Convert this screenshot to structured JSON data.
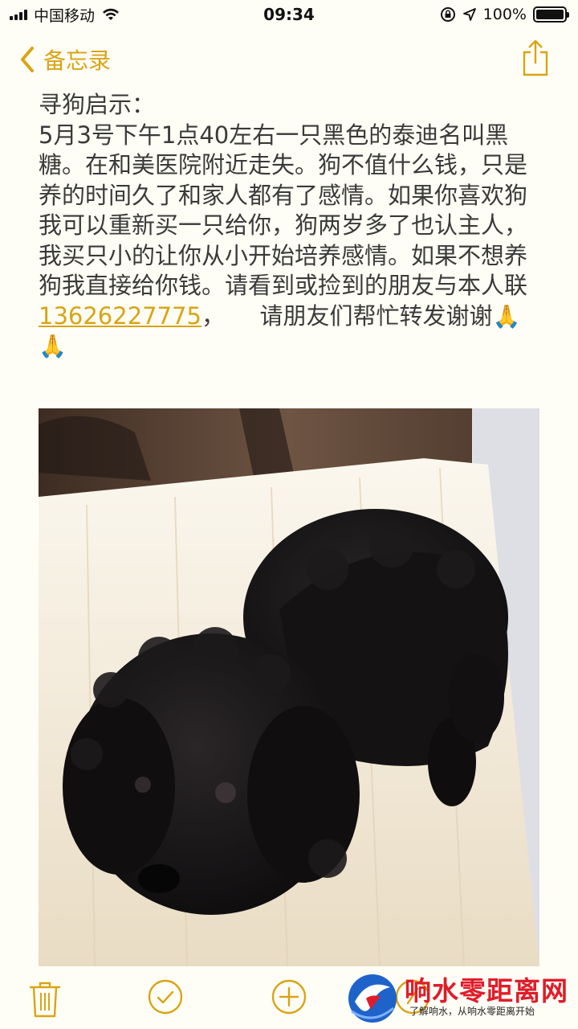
{
  "status": {
    "carrier": "中国移动",
    "time": "09:34",
    "battery_text": "100%",
    "battery_level": 1.0
  },
  "nav": {
    "back_label": "备忘录"
  },
  "note": {
    "title": "寻狗启示：",
    "body_before_phone": "5月3号下午1点40左右一只黑色的泰迪名叫黑糖。在和美医院附近走失。狗不值什么钱，只是养的时间久了和家人都有了感情。如果你喜欢狗我可以重新买一只给你，狗两岁多了也认主人，我买只小的让你从小开始培养感情。如果不想养狗我直接给你钱。请看到或捡到的朋友与本人联",
    "phone": "13626227775",
    "body_after_phone": "，　　请朋友们帮忙转发谢谢",
    "emoji": "🙏🙏"
  },
  "watermark": {
    "title": "响水零距离网",
    "subtitle": "了解响水，从响水零距离开始"
  },
  "colors": {
    "accent": "#d9a414",
    "background": "#fffef6",
    "watermark_red": "#e01c2a"
  },
  "icons": [
    "signal-icon",
    "wifi-icon",
    "lock-rotation-icon",
    "location-icon",
    "battery-icon",
    "chevron-left-icon",
    "share-icon",
    "trash-icon",
    "checklist-icon",
    "add-icon",
    "compose-icon"
  ]
}
